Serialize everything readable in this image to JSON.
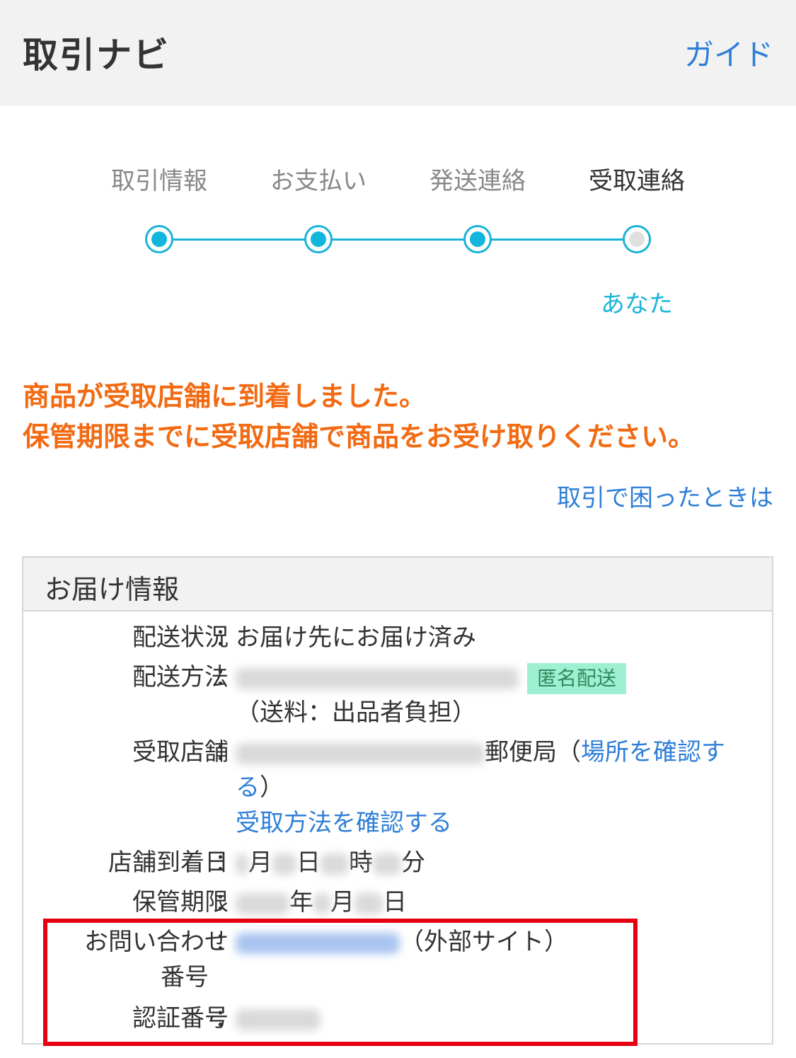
{
  "header": {
    "title": "取引ナビ",
    "guide_link": "ガイド"
  },
  "steps": {
    "items": [
      {
        "label": "取引情報",
        "state": "done"
      },
      {
        "label": "お支払い",
        "state": "done"
      },
      {
        "label": "発送連絡",
        "state": "done"
      },
      {
        "label": "受取連絡",
        "state": "current"
      }
    ],
    "current_role": "あなた",
    "accent_color": "#1ab3d8"
  },
  "notice": {
    "line1": "商品が受取店舗に到着しました。",
    "line2": "保管期限までに受取店舗で商品をお受け取りください。",
    "color": "#f26a12"
  },
  "help_link": "取引で困ったときは",
  "delivery": {
    "title": "お届け情報",
    "colon": "：",
    "status": {
      "label": "配送状況",
      "value": "お届け先にお届け済み"
    },
    "method": {
      "label": "配送方法",
      "badge": "匿名配送",
      "fee": "（送料：出品者負担）"
    },
    "store": {
      "label": "受取店舗",
      "suffix": "郵便局",
      "paren_open": "（",
      "location_link": "場所を確認す",
      "location_link_cont": "る",
      "paren_close": "）",
      "method_link": "受取方法を確認する"
    },
    "arrival": {
      "label": "店舗到着日",
      "month": "月",
      "day": "日",
      "hour": "時",
      "minute": "分"
    },
    "deadline": {
      "label": "保管期限",
      "year": "年",
      "month": "月",
      "day": "日"
    },
    "inquiry": {
      "label_line1": "お問い合わせ",
      "label_line2": "番号",
      "external": "（外部サイト）"
    },
    "auth": {
      "label": "認証番号"
    }
  },
  "highlight_color": "#e60012"
}
